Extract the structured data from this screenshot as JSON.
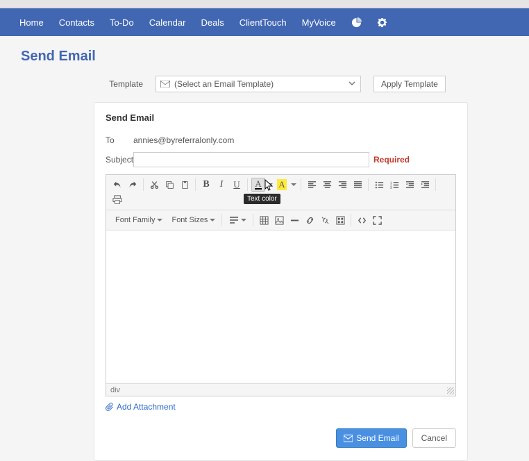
{
  "nav": {
    "items": [
      "Home",
      "Contacts",
      "To-Do",
      "Calendar",
      "Deals",
      "ClientTouch",
      "MyVoice"
    ]
  },
  "page": {
    "title": "Send Email"
  },
  "template": {
    "label": "Template",
    "placeholder": "(Select an Email Template)",
    "apply": "Apply Template"
  },
  "card": {
    "heading": "Send Email",
    "to_label": "To",
    "to_value": "annies@byreferralonly.com",
    "subject_label": "Subject",
    "subject_value": "",
    "required": "Required"
  },
  "editor": {
    "font_family": "Font Family",
    "font_sizes": "Font Sizes",
    "tooltip": "Text color",
    "status": "div"
  },
  "attach": {
    "label": "Add Attachment"
  },
  "footer": {
    "send": "Send Email",
    "cancel": "Cancel"
  }
}
